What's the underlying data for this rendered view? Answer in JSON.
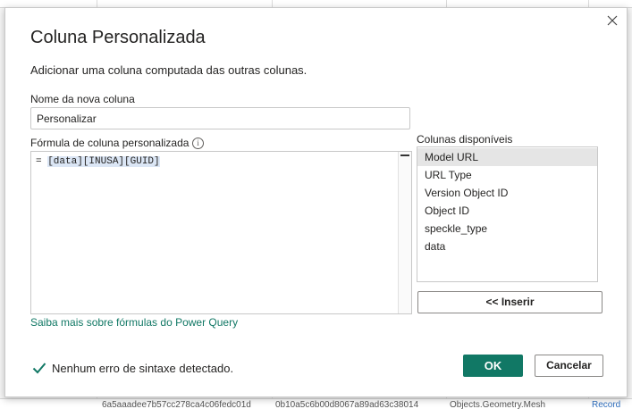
{
  "dialog": {
    "title": "Coluna Personalizada",
    "subtitle": "Adicionar uma coluna computada das outras colunas."
  },
  "name_field": {
    "label": "Nome da nova coluna",
    "value": "Personalizar"
  },
  "formula": {
    "label": "Fórmula de coluna personalizada",
    "prefix": "= ",
    "expression": "[data][INUSA][GUID]"
  },
  "available_columns": {
    "label": "Colunas disponíveis",
    "items": [
      "Model URL",
      "URL Type",
      "Version Object ID",
      "Object ID",
      "speckle_type",
      "data"
    ],
    "selected": "Model URL"
  },
  "insert_button": {
    "label": "<< Inserir"
  },
  "learn_link": {
    "label": "Saiba mais sobre fórmulas do Power Query"
  },
  "status": {
    "text": "Nenhum erro de sintaxe detectado."
  },
  "buttons": {
    "ok": "OK",
    "cancel": "Cancelar"
  },
  "background_row": {
    "cell1": "6a5aaadee7b57cc278ca4c06fedc01d",
    "cell2": "0b10a5c6b00d8067a89ad63c38014",
    "cell3": "Objects.Geometry.Mesh",
    "cell4": "Record"
  },
  "colors": {
    "accent": "#117865",
    "selected_item": "#e5e5e5",
    "formula_highlight": "#dbe6f5"
  }
}
